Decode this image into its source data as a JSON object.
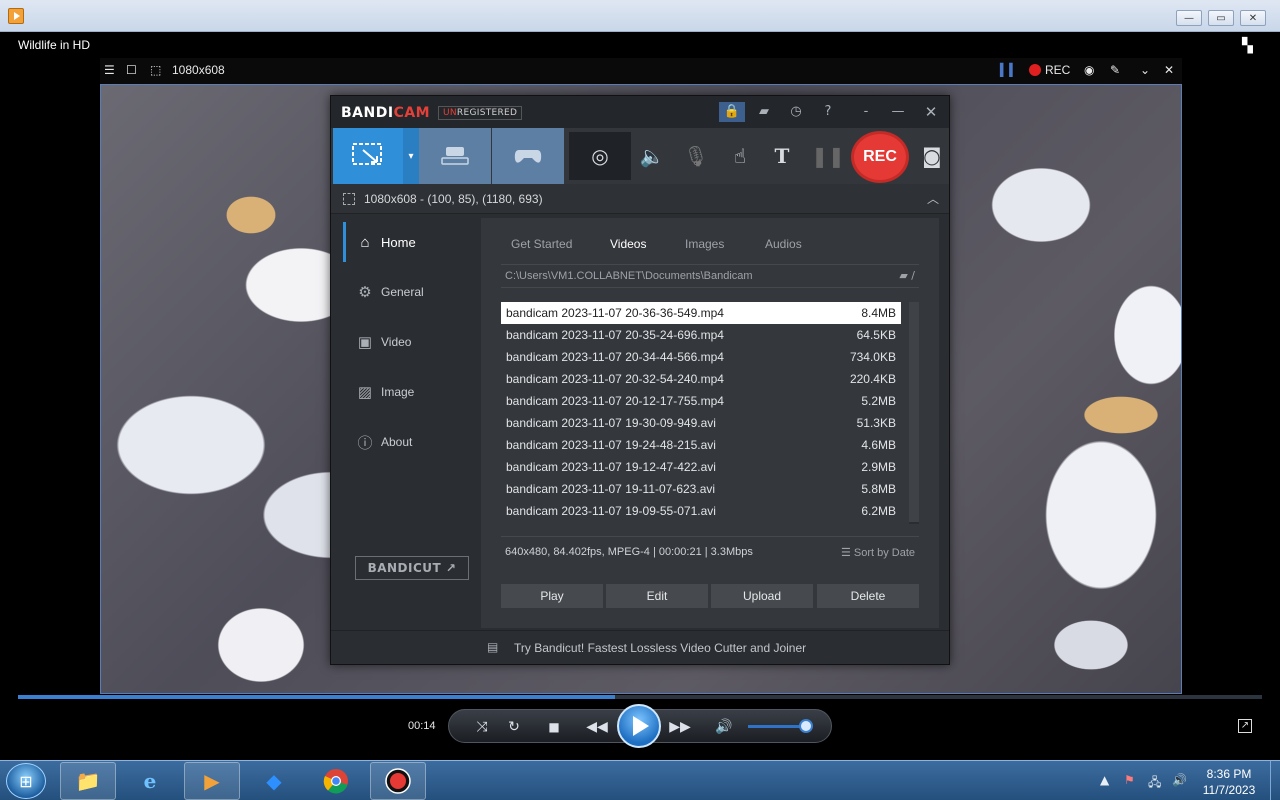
{
  "wmp": {
    "title": "Wildlife in HD",
    "window_controls": {
      "minimize": "—",
      "restore": "▭",
      "close": "✕"
    },
    "time": "00:14",
    "progress_fraction": 0.48,
    "volume_fraction": 0.9
  },
  "video_toolbar": {
    "size_label": "1080x608",
    "rec_label": "REC"
  },
  "bandicam": {
    "logo_band": "BANDI",
    "logo_cam": "CAM",
    "unregistered_prefix": "UN",
    "unregistered_rest": "REGISTERED",
    "area_text": "1080x608 - (100, 85), (1180, 693)",
    "rec_button": "REC",
    "sidebar": [
      {
        "label": "Home",
        "icon": "home-icon",
        "glyph": "⌂"
      },
      {
        "label": "General",
        "icon": "gear-icon",
        "glyph": "⚙"
      },
      {
        "label": "Video",
        "icon": "video-icon",
        "glyph": "▣"
      },
      {
        "label": "Image",
        "icon": "image-icon",
        "glyph": "▨"
      },
      {
        "label": "About",
        "icon": "info-icon",
        "glyph": "ⓘ"
      }
    ],
    "bandicut_label": "BANDICUT ↗",
    "tabs": [
      "Get Started",
      "Videos",
      "Images",
      "Audios"
    ],
    "active_tab": "Videos",
    "path": "C:\\Users\\VM1.COLLABNET\\Documents\\Bandicam",
    "path_folder": "/",
    "files": [
      {
        "name": "bandicam 2023-11-07 20-36-36-549.mp4",
        "size": "8.4MB"
      },
      {
        "name": "bandicam 2023-11-07 20-35-24-696.mp4",
        "size": "64.5KB"
      },
      {
        "name": "bandicam 2023-11-07 20-34-44-566.mp4",
        "size": "734.0KB"
      },
      {
        "name": "bandicam 2023-11-07 20-32-54-240.mp4",
        "size": "220.4KB"
      },
      {
        "name": "bandicam 2023-11-07 20-12-17-755.mp4",
        "size": "5.2MB"
      },
      {
        "name": "bandicam 2023-11-07 19-30-09-949.avi",
        "size": "51.3KB"
      },
      {
        "name": "bandicam 2023-11-07 19-24-48-215.avi",
        "size": "4.6MB"
      },
      {
        "name": "bandicam 2023-11-07 19-12-47-422.avi",
        "size": "2.9MB"
      },
      {
        "name": "bandicam 2023-11-07 19-11-07-623.avi",
        "size": "5.8MB"
      },
      {
        "name": "bandicam 2023-11-07 19-09-55-071.avi",
        "size": "6.2MB"
      }
    ],
    "info": "640x480, 84.402fps, MPEG-4 | 00:00:21 | 3.3Mbps",
    "sort_label": "Sort by Date",
    "actions": [
      "Play",
      "Edit",
      "Upload",
      "Delete"
    ],
    "footer": "Try Bandicut! Fastest Lossless Video Cutter and Joiner"
  },
  "taskbar": {
    "clock_time": "8:36 PM",
    "clock_date": "11/7/2023"
  },
  "colors": {
    "accent": "#2f8fd8",
    "rec": "#e53935"
  }
}
